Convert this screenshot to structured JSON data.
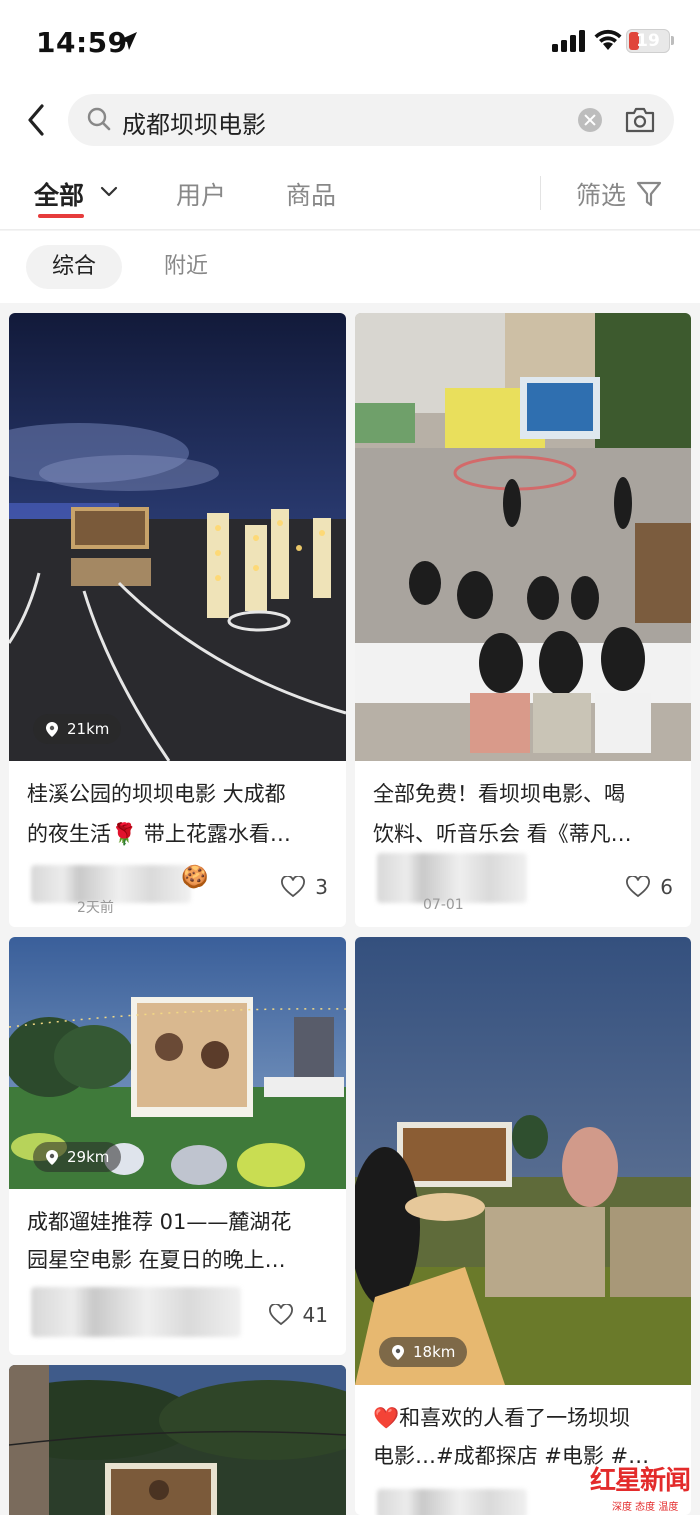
{
  "status_bar": {
    "time": "14:59",
    "battery": "19"
  },
  "search": {
    "query": "成都坝坝电影"
  },
  "tabs": {
    "all": "全部",
    "user": "用户",
    "goods": "商品",
    "filter": "筛选"
  },
  "subtabs": {
    "general": "综合",
    "nearby": "附近"
  },
  "feed": [
    {
      "title_line1": "桂溪公园的坝坝电影 大成都",
      "title_line2": "的夜生活🌹 带上花露水看…",
      "distance": "21km",
      "likes": "3",
      "date": "2天前"
    },
    {
      "title_line1": "全部免费！看坝坝电影、喝",
      "title_line2": "饮料、听音乐会 看《蒂凡…",
      "likes": "6",
      "date": "07-01"
    },
    {
      "title_line1": "成都遛娃推荐 01——麓湖花",
      "title_line2": "园星空电影 在夏日的晚上…",
      "distance": "29km",
      "likes": "41"
    },
    {
      "title_line1": "❤️和喜欢的人看了一场坝坝",
      "title_line2": "电影…#成都探店 #电影 #…",
      "distance": "18km"
    }
  ],
  "watermark": {
    "name": "红星新闻",
    "sub": "深度 态度 温度"
  },
  "colors": {
    "accent": "#e63c3c",
    "background": "#f4f4f4"
  }
}
